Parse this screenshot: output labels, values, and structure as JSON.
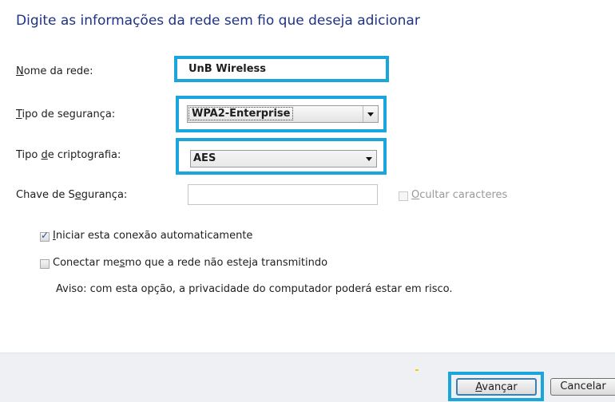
{
  "heading": "Digite as informações da rede sem fio que deseja adicionar",
  "fields": {
    "network_name": {
      "label_pre": "",
      "label_ul": "N",
      "label_post": "ome da rede:",
      "value": "UnB Wireless"
    },
    "security_type": {
      "label_pre": "",
      "label_ul": "T",
      "label_post": "ipo de segurança:",
      "value": "WPA2-Enterprise"
    },
    "encryption_type": {
      "label_pre": "Tipo ",
      "label_ul": "d",
      "label_post": "e criptografia:",
      "value": "AES"
    },
    "security_key": {
      "label_pre": "Chave de S",
      "label_ul": "e",
      "label_post": "gurança:",
      "value": ""
    }
  },
  "hide_chars": {
    "label_ul": "O",
    "label_post": "cultar caracteres",
    "checked": false,
    "enabled": false
  },
  "options": {
    "auto_start": {
      "label_ul": "I",
      "label_post": "niciar esta conexão automaticamente",
      "checked": true
    },
    "connect_hidden": {
      "label_pre": "Conectar me",
      "label_ul": "s",
      "label_post": "mo que a rede não esteja transmitindo",
      "checked": false
    }
  },
  "warning": "Aviso: com esta opção, a privacidade do computador poderá estar em risco.",
  "buttons": {
    "next_ul": "A",
    "next_post": "vançar",
    "cancel": "Cancelar"
  },
  "colors": {
    "highlight": "#1aa5dc",
    "heading": "#1e3287",
    "footer": "#eef0f3"
  }
}
